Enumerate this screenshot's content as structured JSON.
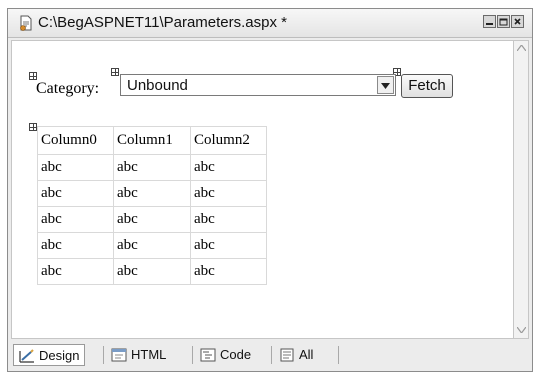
{
  "window": {
    "title": "C:\\BegASPNET11\\Parameters.aspx *"
  },
  "form": {
    "category_label": "Category:",
    "category_value": "Unbound",
    "fetch_label": "Fetch"
  },
  "grid": {
    "headers": [
      "Column0",
      "Column1",
      "Column2"
    ],
    "rows": [
      [
        "abc",
        "abc",
        "abc"
      ],
      [
        "abc",
        "abc",
        "abc"
      ],
      [
        "abc",
        "abc",
        "abc"
      ],
      [
        "abc",
        "abc",
        "abc"
      ],
      [
        "abc",
        "abc",
        "abc"
      ]
    ]
  },
  "view_tabs": {
    "design": "Design",
    "html": "HTML",
    "code": "Code",
    "all": "All",
    "active": "Design"
  }
}
